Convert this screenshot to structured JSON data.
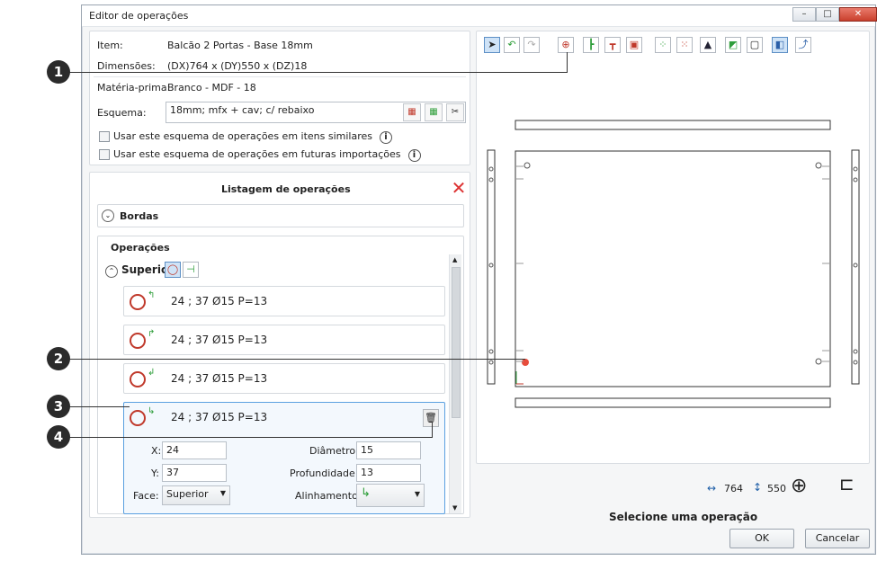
{
  "window": {
    "title": "Editor de operações"
  },
  "info": {
    "item_label": "Item:",
    "item_value": "Balcão 2 Portas - Base 18mm",
    "dim_label": "Dimensões:",
    "dim_value": "(DX)764 x (DY)550 x (DZ)18",
    "mat_label": "Matéria-prima:",
    "mat_value": "Branco - MDF - 18",
    "schema_label": "Esquema:",
    "schema_value": "18mm; mfx + cav; c/ rebaixo",
    "check1": "Usar este esquema de operações em itens similares",
    "check2": "Usar este esquema de operações em futuras importações"
  },
  "list": {
    "title": "Listagem de operações",
    "bordas": "Bordas",
    "operacoes": "Operações",
    "superior": "Superior",
    "ops": [
      "24 ; 37 Ø15 P=13",
      "24 ; 37 Ø15 P=13",
      "24 ; 37 Ø15 P=13",
      "24 ; 37 Ø15 P=13"
    ]
  },
  "detail": {
    "x_label": "X:",
    "x_value": "24",
    "y_label": "Y:",
    "y_value": "37",
    "face_label": "Face:",
    "face_value": "Superior",
    "diam_label": "Diâmetro:",
    "diam_value": "15",
    "prof_label": "Profundidade:",
    "prof_value": "13",
    "align_label": "Alinhamento:"
  },
  "footer": {
    "dx": "764",
    "dy": "550",
    "status": "Selecione uma operação",
    "ok": "OK",
    "cancel": "Cancelar"
  },
  "callouts": [
    "1",
    "2",
    "3",
    "4"
  ],
  "colors": {
    "accent_red": "#c0392b",
    "selection_blue": "#5aa0e0",
    "green": "#2e9e3a"
  }
}
